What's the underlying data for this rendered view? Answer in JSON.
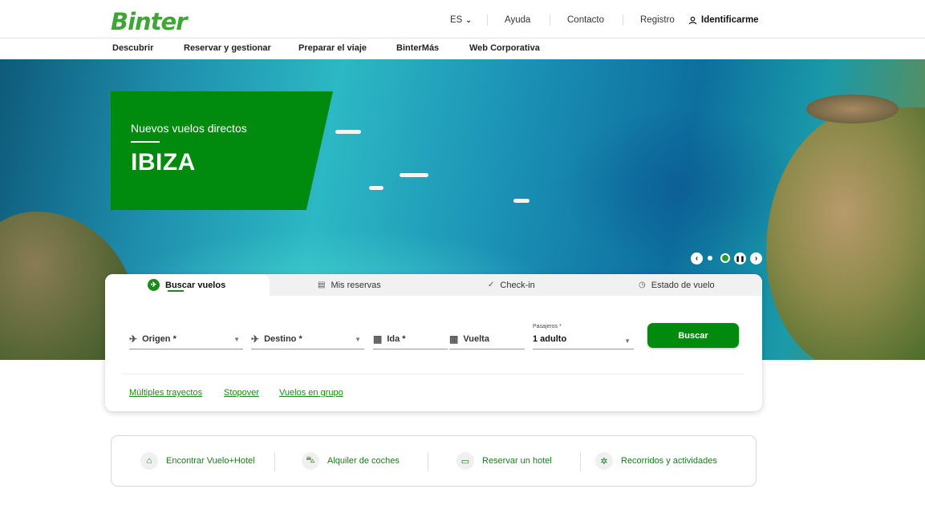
{
  "header": {
    "logo": "Binter",
    "lang": "ES",
    "help": "Ayuda",
    "contact": "Contacto",
    "register": "Registro",
    "login": "Identificarme"
  },
  "nav": [
    "Descubrir",
    "Reservar y gestionar",
    "Preparar el viaje",
    "BinterMás",
    "Web Corporativa"
  ],
  "hero": {
    "subtitle": "Nuevos vuelos directos",
    "title": "IBIZA"
  },
  "search": {
    "tabs": [
      "Buscar vuelos",
      "Mis reservas",
      "Check-in",
      "Estado de vuelo"
    ],
    "origin": "Origen *",
    "destination": "Destino *",
    "departure": "Ida *",
    "return": "Vuelta",
    "passengers_label": "Pasajeros *",
    "passengers_value": "1 adulto",
    "submit": "Buscar",
    "links": [
      "Múltiples trayectos",
      "Stopover",
      "Vuelos en grupo"
    ]
  },
  "services": [
    "Encontrar Vuelo+Hotel",
    "Alquiler de coches",
    "Reservar un hotel",
    "Recorridos y actividades"
  ],
  "colors": {
    "brand_green": "#008a0e",
    "logo_green": "#3fa535",
    "link_green": "#1a8a1a"
  },
  "icons": {
    "login": "user-icon",
    "flight_tab": "plane-icon",
    "bookings_tab": "ticket-icon",
    "checkin_tab": "check-icon",
    "status_tab": "clock-icon",
    "origin": "takeoff-icon",
    "destination": "landing-icon",
    "calendar": "calendar-icon",
    "services": [
      "bed-icon",
      "car-icon",
      "hotel-icon",
      "activities-icon"
    ]
  }
}
